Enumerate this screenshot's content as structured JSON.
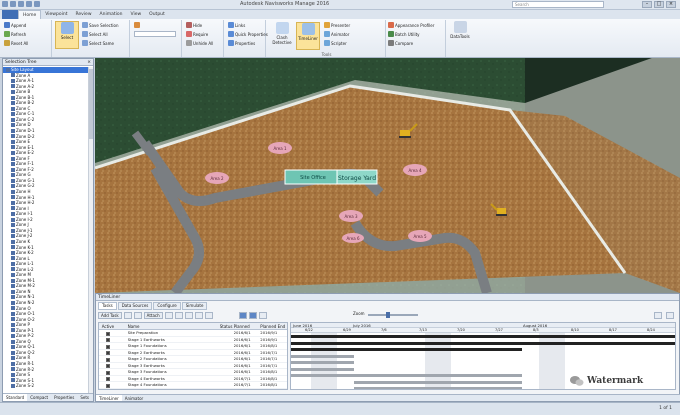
{
  "titlebar": {
    "title": "Autodesk Navisworks Manage 2016",
    "search_placeholder": "Search"
  },
  "tabs": [
    "Home",
    "Viewpoint",
    "Review",
    "Animation",
    "View",
    "Output"
  ],
  "ribbon": {
    "project": [
      "Append",
      "Refresh",
      "Reset All"
    ],
    "select": [
      "Select",
      "Save Selection",
      "Select All",
      "Select Same"
    ],
    "visibility": [
      "Hide",
      "Require",
      "Unhide All"
    ],
    "display": [
      "Links",
      "Quick Properties",
      "Properties"
    ],
    "tools": {
      "clash": "Clash Detective",
      "timeliner": "TimeLiner",
      "presenter": "Presenter",
      "animator": "Animator",
      "scripter": "Scripter",
      "appearance": "Appearance Profiler",
      "batch": "Batch Utility",
      "compare": "Compare",
      "datatools": "DataTools",
      "group_label": "Tools"
    }
  },
  "tree_panel": {
    "title": "Selection Tree",
    "items": [
      "Site Layout",
      "Zone A",
      "Zone A-1",
      "Zone A-2",
      "Zone B",
      "Zone B-1",
      "Zone B-2",
      "Zone C",
      "Zone C-1",
      "Zone C-2",
      "Zone D",
      "Zone D-1",
      "Zone D-2",
      "Zone E",
      "Zone E-1",
      "Zone E-2",
      "Zone F",
      "Zone F-1",
      "Zone F-2",
      "Zone G",
      "Zone G-1",
      "Zone G-2",
      "Zone H",
      "Zone H-1",
      "Zone H-2",
      "Zone I",
      "Zone I-1",
      "Zone I-2",
      "Zone J",
      "Zone J-1",
      "Zone J-2",
      "Zone K",
      "Zone K-1",
      "Zone K-2",
      "Zone L",
      "Zone L-1",
      "Zone L-2",
      "Zone M",
      "Zone M-1",
      "Zone M-2",
      "Zone N",
      "Zone N-1",
      "Zone N-2",
      "Zone O",
      "Zone O-1",
      "Zone O-2",
      "Zone P",
      "Zone P-1",
      "Zone P-2",
      "Zone Q",
      "Zone Q-1",
      "Zone Q-2",
      "Zone R",
      "Zone R-1",
      "Zone R-2",
      "Zone S",
      "Zone S-1",
      "Zone S-2"
    ],
    "selected_index": 0,
    "tabs": [
      "Standard",
      "Compact",
      "Properties",
      "Sets"
    ]
  },
  "viewport": {
    "labels": [
      "Area 1",
      "Area 2",
      "Area 3",
      "Area 4",
      "Area 5",
      "Area 6"
    ],
    "sign_left": "Site Office",
    "sign_right": "Storage Yard"
  },
  "timeliner": {
    "title": "TimeLiner",
    "tabs": [
      "Tasks",
      "Data Sources",
      "Configure",
      "Simulate"
    ],
    "toolbar_add": "Add Task",
    "toolbar_attach": "Attach",
    "zoom_label": "Zoom",
    "columns": [
      "Active",
      "",
      "Name",
      "Status",
      "Planned Start",
      "Planned End"
    ],
    "rows": [
      {
        "name": "Site Preparation",
        "start": "2016/6/1",
        "end": "2016/9/1",
        "checked": true
      },
      {
        "name": "Stage 1 Earthworks",
        "start": "2016/6/1",
        "end": "2016/9/1",
        "checked": true
      },
      {
        "name": "Stage 1 Foundations",
        "start": "2016/6/1",
        "end": "2016/8/1",
        "checked": true
      },
      {
        "name": "Stage 2 Earthworks",
        "start": "2016/6/1",
        "end": "2016/7/1",
        "checked": true
      },
      {
        "name": "Stage 2 Foundations",
        "start": "2016/6/1",
        "end": "2016/7/1",
        "checked": true
      },
      {
        "name": "Stage 3 Earthworks",
        "start": "2016/6/1",
        "end": "2016/7/1",
        "checked": true
      },
      {
        "name": "Stage 3 Foundations",
        "start": "2016/6/1",
        "end": "2016/8/1",
        "checked": true
      },
      {
        "name": "Stage 4 Earthworks",
        "start": "2016/7/1",
        "end": "2016/8/1",
        "checked": true
      },
      {
        "name": "Stage 4 Foundations",
        "start": "2016/7/1",
        "end": "2016/8/1",
        "checked": true
      }
    ],
    "months": [
      "June 2016",
      "July 2016",
      "August 2016"
    ],
    "weeks": [
      "6/22",
      "6/29",
      "7/6",
      "7/13",
      "7/20",
      "7/27",
      "8/3",
      "8/10",
      "8/17",
      "8/24"
    ],
    "bottom_tabs": [
      "TimeLiner",
      "Animator"
    ]
  },
  "statusbar": {
    "text": "1 of 1"
  },
  "watermark": {
    "text": "Watermark"
  }
}
